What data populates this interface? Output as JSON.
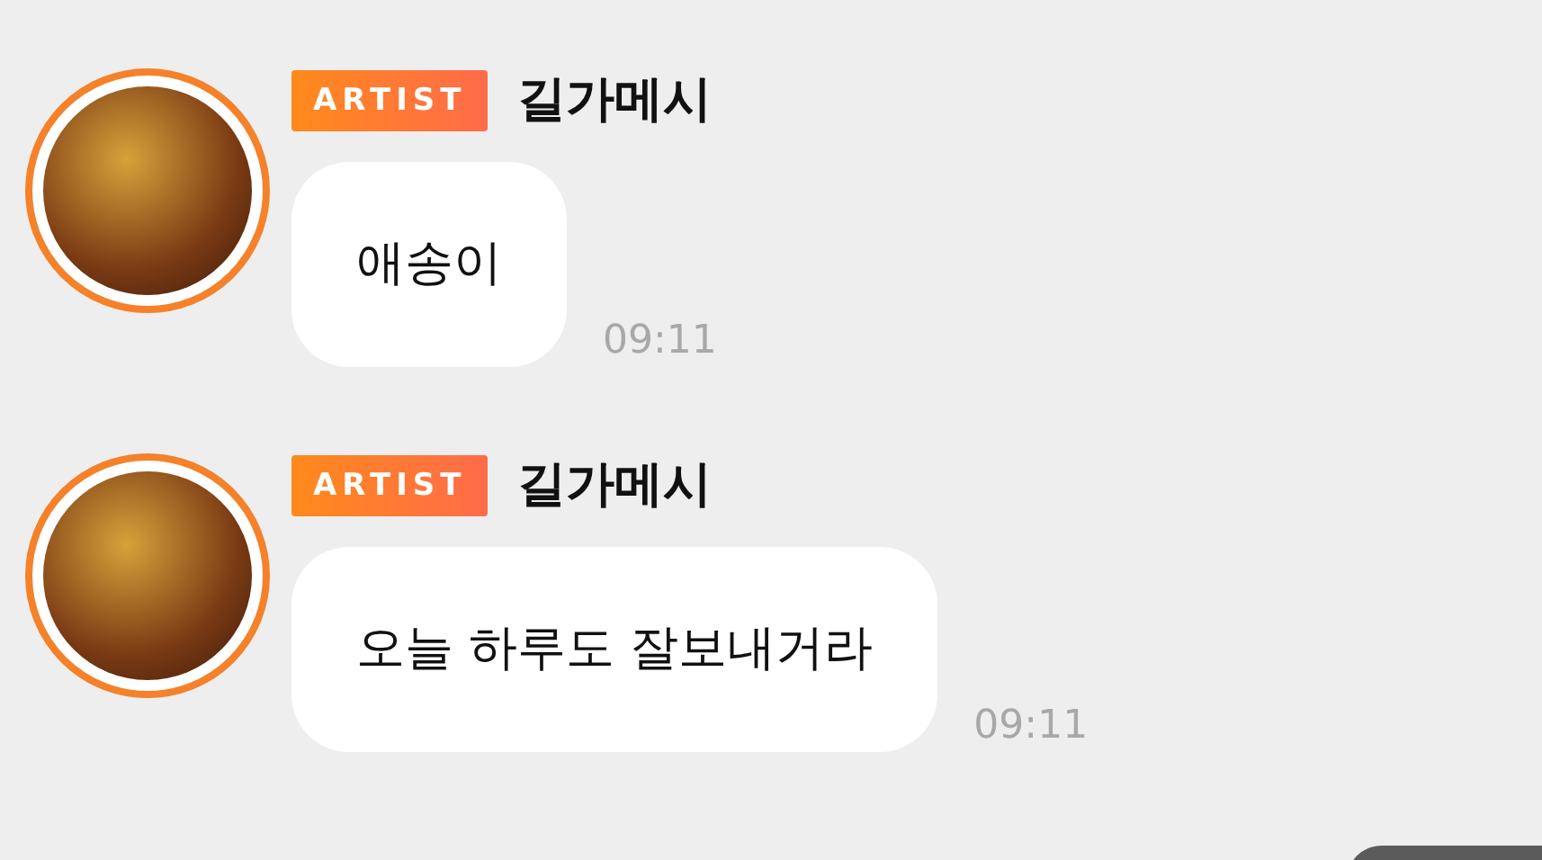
{
  "messages": [
    {
      "badge": "ARTIST",
      "sender": "길가메시",
      "text": "애송이",
      "time": "09:11"
    },
    {
      "badge": "ARTIST",
      "sender": "길가메시",
      "text": "오늘 하루도 잘보내거라",
      "time": "09:11"
    }
  ]
}
